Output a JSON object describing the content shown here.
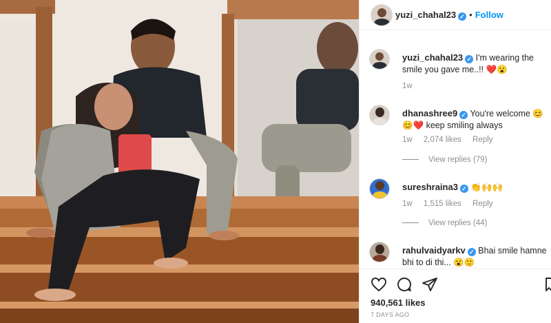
{
  "post": {
    "author": "yuzi_chahal23",
    "follow_label": "Follow",
    "caption": "I'm wearing the smile you gave me..!! ❤️😮",
    "caption_age": "1w"
  },
  "comments": [
    {
      "username": "dhanashree9",
      "verified": true,
      "text": "You're welcome 😊😊❤️ keep smiling always",
      "age": "1w",
      "likes": "2,074 likes",
      "reply_label": "Reply",
      "view_replies": "View replies (79)"
    },
    {
      "username": "sureshraina3",
      "verified": true,
      "text": "👏🙌🙌",
      "age": "1w",
      "likes": "1,515 likes",
      "reply_label": "Reply",
      "view_replies": "View replies (44)"
    },
    {
      "username": "rahulvaidyarkv",
      "verified": true,
      "text": "Bhai smile hamne bhi to di thi... 😮🙂"
    }
  ],
  "footer": {
    "likes": "940,561 likes",
    "posted": "7 DAYS AGO"
  },
  "icons": {
    "like": "heart-icon",
    "comment": "comment-icon",
    "share": "share-icon",
    "save": "bookmark-icon",
    "verified": "verified-badge-icon",
    "comment_like": "heart-outline-icon"
  },
  "colors": {
    "follow": "#0095f6",
    "verified": "#3897f0",
    "muted": "#8e8e8e"
  }
}
